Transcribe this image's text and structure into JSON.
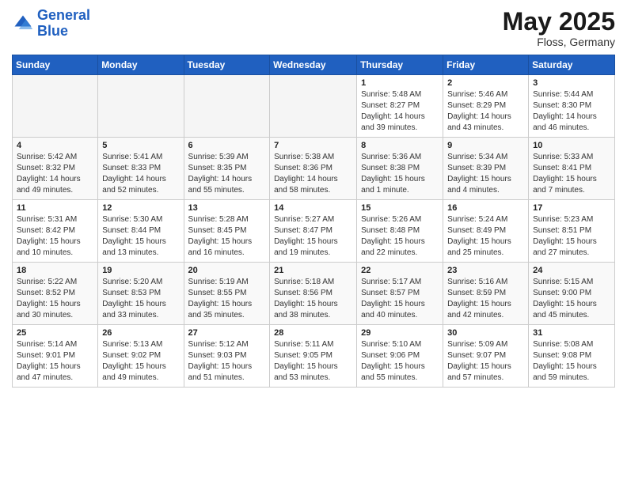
{
  "header": {
    "logo_line1": "General",
    "logo_line2": "Blue",
    "month_title": "May 2025",
    "location": "Floss, Germany"
  },
  "weekdays": [
    "Sunday",
    "Monday",
    "Tuesday",
    "Wednesday",
    "Thursday",
    "Friday",
    "Saturday"
  ],
  "weeks": [
    [
      {
        "day": "",
        "info": ""
      },
      {
        "day": "",
        "info": ""
      },
      {
        "day": "",
        "info": ""
      },
      {
        "day": "",
        "info": ""
      },
      {
        "day": "1",
        "info": "Sunrise: 5:48 AM\nSunset: 8:27 PM\nDaylight: 14 hours\nand 39 minutes."
      },
      {
        "day": "2",
        "info": "Sunrise: 5:46 AM\nSunset: 8:29 PM\nDaylight: 14 hours\nand 43 minutes."
      },
      {
        "day": "3",
        "info": "Sunrise: 5:44 AM\nSunset: 8:30 PM\nDaylight: 14 hours\nand 46 minutes."
      }
    ],
    [
      {
        "day": "4",
        "info": "Sunrise: 5:42 AM\nSunset: 8:32 PM\nDaylight: 14 hours\nand 49 minutes."
      },
      {
        "day": "5",
        "info": "Sunrise: 5:41 AM\nSunset: 8:33 PM\nDaylight: 14 hours\nand 52 minutes."
      },
      {
        "day": "6",
        "info": "Sunrise: 5:39 AM\nSunset: 8:35 PM\nDaylight: 14 hours\nand 55 minutes."
      },
      {
        "day": "7",
        "info": "Sunrise: 5:38 AM\nSunset: 8:36 PM\nDaylight: 14 hours\nand 58 minutes."
      },
      {
        "day": "8",
        "info": "Sunrise: 5:36 AM\nSunset: 8:38 PM\nDaylight: 15 hours\nand 1 minute."
      },
      {
        "day": "9",
        "info": "Sunrise: 5:34 AM\nSunset: 8:39 PM\nDaylight: 15 hours\nand 4 minutes."
      },
      {
        "day": "10",
        "info": "Sunrise: 5:33 AM\nSunset: 8:41 PM\nDaylight: 15 hours\nand 7 minutes."
      }
    ],
    [
      {
        "day": "11",
        "info": "Sunrise: 5:31 AM\nSunset: 8:42 PM\nDaylight: 15 hours\nand 10 minutes."
      },
      {
        "day": "12",
        "info": "Sunrise: 5:30 AM\nSunset: 8:44 PM\nDaylight: 15 hours\nand 13 minutes."
      },
      {
        "day": "13",
        "info": "Sunrise: 5:28 AM\nSunset: 8:45 PM\nDaylight: 15 hours\nand 16 minutes."
      },
      {
        "day": "14",
        "info": "Sunrise: 5:27 AM\nSunset: 8:47 PM\nDaylight: 15 hours\nand 19 minutes."
      },
      {
        "day": "15",
        "info": "Sunrise: 5:26 AM\nSunset: 8:48 PM\nDaylight: 15 hours\nand 22 minutes."
      },
      {
        "day": "16",
        "info": "Sunrise: 5:24 AM\nSunset: 8:49 PM\nDaylight: 15 hours\nand 25 minutes."
      },
      {
        "day": "17",
        "info": "Sunrise: 5:23 AM\nSunset: 8:51 PM\nDaylight: 15 hours\nand 27 minutes."
      }
    ],
    [
      {
        "day": "18",
        "info": "Sunrise: 5:22 AM\nSunset: 8:52 PM\nDaylight: 15 hours\nand 30 minutes."
      },
      {
        "day": "19",
        "info": "Sunrise: 5:20 AM\nSunset: 8:53 PM\nDaylight: 15 hours\nand 33 minutes."
      },
      {
        "day": "20",
        "info": "Sunrise: 5:19 AM\nSunset: 8:55 PM\nDaylight: 15 hours\nand 35 minutes."
      },
      {
        "day": "21",
        "info": "Sunrise: 5:18 AM\nSunset: 8:56 PM\nDaylight: 15 hours\nand 38 minutes."
      },
      {
        "day": "22",
        "info": "Sunrise: 5:17 AM\nSunset: 8:57 PM\nDaylight: 15 hours\nand 40 minutes."
      },
      {
        "day": "23",
        "info": "Sunrise: 5:16 AM\nSunset: 8:59 PM\nDaylight: 15 hours\nand 42 minutes."
      },
      {
        "day": "24",
        "info": "Sunrise: 5:15 AM\nSunset: 9:00 PM\nDaylight: 15 hours\nand 45 minutes."
      }
    ],
    [
      {
        "day": "25",
        "info": "Sunrise: 5:14 AM\nSunset: 9:01 PM\nDaylight: 15 hours\nand 47 minutes."
      },
      {
        "day": "26",
        "info": "Sunrise: 5:13 AM\nSunset: 9:02 PM\nDaylight: 15 hours\nand 49 minutes."
      },
      {
        "day": "27",
        "info": "Sunrise: 5:12 AM\nSunset: 9:03 PM\nDaylight: 15 hours\nand 51 minutes."
      },
      {
        "day": "28",
        "info": "Sunrise: 5:11 AM\nSunset: 9:05 PM\nDaylight: 15 hours\nand 53 minutes."
      },
      {
        "day": "29",
        "info": "Sunrise: 5:10 AM\nSunset: 9:06 PM\nDaylight: 15 hours\nand 55 minutes."
      },
      {
        "day": "30",
        "info": "Sunrise: 5:09 AM\nSunset: 9:07 PM\nDaylight: 15 hours\nand 57 minutes."
      },
      {
        "day": "31",
        "info": "Sunrise: 5:08 AM\nSunset: 9:08 PM\nDaylight: 15 hours\nand 59 minutes."
      }
    ]
  ]
}
